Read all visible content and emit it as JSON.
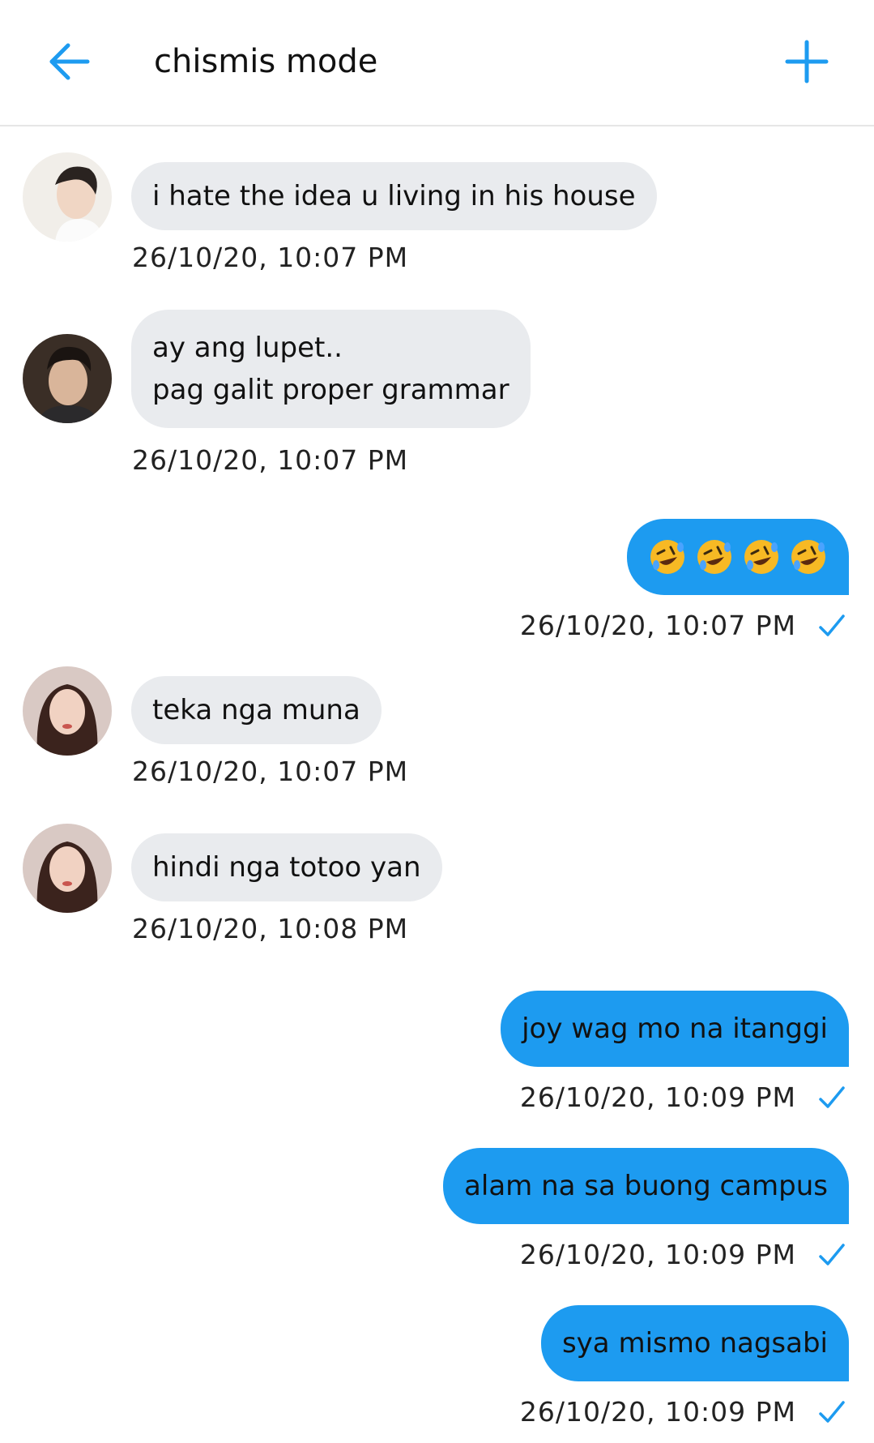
{
  "header": {
    "title": "chismis mode",
    "back_icon": "arrow-left-icon",
    "add_icon": "plus-icon",
    "accent_color": "#1d9bf0"
  },
  "messages": [
    {
      "direction": "incoming",
      "avatar": "avatar-man-1",
      "lines": [
        "i hate the idea u living in his house"
      ],
      "timestamp": "26/10/20, 10:07 PM"
    },
    {
      "direction": "incoming",
      "avatar": "avatar-man-2",
      "lines": [
        "ay ang lupet..",
        "pag galit proper grammar"
      ],
      "timestamp": "26/10/20, 10:07 PM"
    },
    {
      "direction": "outgoing",
      "emoji": "rolling-on-floor-laughing-emoji",
      "emoji_count": 4,
      "timestamp": "26/10/20, 10:07 PM",
      "status": "sent-check"
    },
    {
      "direction": "incoming",
      "avatar": "avatar-woman",
      "lines": [
        "teka nga muna"
      ],
      "timestamp": "26/10/20, 10:07 PM"
    },
    {
      "direction": "incoming",
      "avatar": "avatar-woman",
      "lines": [
        "hindi nga totoo yan"
      ],
      "timestamp": "26/10/20, 10:08 PM"
    },
    {
      "direction": "outgoing",
      "lines": [
        "joy wag mo na itanggi"
      ],
      "timestamp": "26/10/20, 10:09 PM",
      "status": "sent-check"
    },
    {
      "direction": "outgoing",
      "lines": [
        "alam na sa buong campus"
      ],
      "timestamp": "26/10/20, 10:09 PM",
      "status": "sent-check"
    },
    {
      "direction": "outgoing",
      "lines": [
        "sya mismo nagsabi"
      ],
      "timestamp": "26/10/20, 10:09 PM",
      "status": "sent-check"
    }
  ]
}
